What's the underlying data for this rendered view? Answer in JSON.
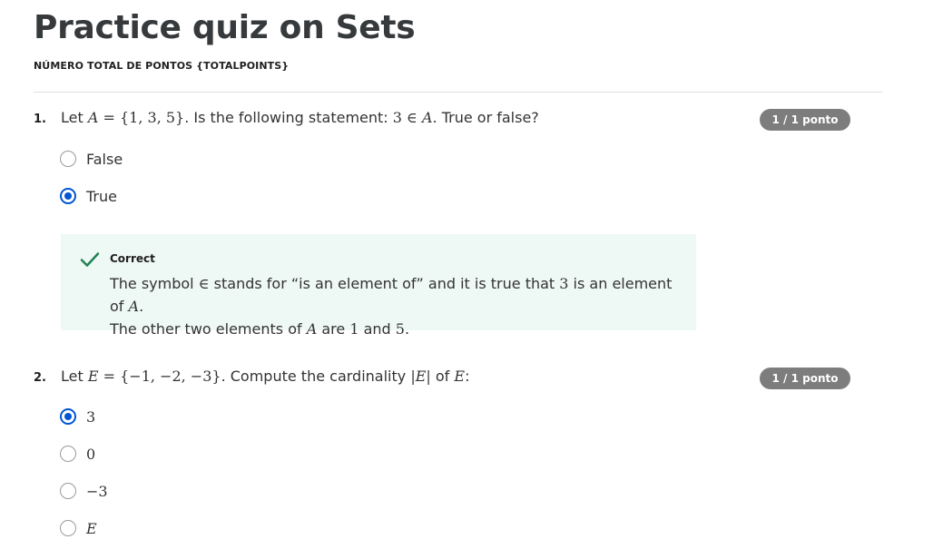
{
  "page": {
    "title": "Practice quiz on Sets",
    "subtitle": "NÚMERO TOTAL DE PONTOS {TOTALPOINTS}"
  },
  "questions": [
    {
      "number": "1.",
      "prefix": "Let ",
      "math_lhs": "A",
      "math_set": " = {1, 3, 5}",
      "mid": ". Is the following statement: ",
      "math_stmt": "3 ∈ ",
      "math_stmt_var": "A",
      "suffix": ". True or false?",
      "score": "1 / 1 ponto",
      "options": [
        {
          "label": "False",
          "selected": false
        },
        {
          "label": "True",
          "selected": true
        }
      ],
      "feedback": {
        "status": "Correct",
        "line1_a": "The symbol ",
        "line1_sym": "∈",
        "line1_b": " stands for “is an element of” and it is true that ",
        "line1_num": "3",
        "line1_c": " is an element of ",
        "line1_var": "A",
        "line1_d": ".",
        "line2_a": "The other two elements of ",
        "line2_var": "A",
        "line2_b": " are ",
        "line2_n1": "1",
        "line2_c": " and ",
        "line2_n2": "5",
        "line2_d": "."
      }
    },
    {
      "number": "2.",
      "prefix": "Let ",
      "math_lhs": "E",
      "math_set": " = {−1, −2, −3}",
      "mid": ". Compute the cardinality ",
      "math_card": "|E|",
      "of": " of ",
      "math_var": "E",
      "suffix": ":",
      "score": "1 / 1 ponto",
      "options": [
        {
          "label": "3",
          "selected": true
        },
        {
          "label": "0",
          "selected": false
        },
        {
          "label": "−3",
          "selected": false
        },
        {
          "label": "E",
          "selected": false
        }
      ]
    }
  ],
  "colors": {
    "accent": "#0056d2",
    "badge": "#7d7d7d",
    "feedback_bg": "#eef8f4",
    "correct_check": "#1f8354"
  },
  "icons": {
    "correct": "check-icon"
  }
}
